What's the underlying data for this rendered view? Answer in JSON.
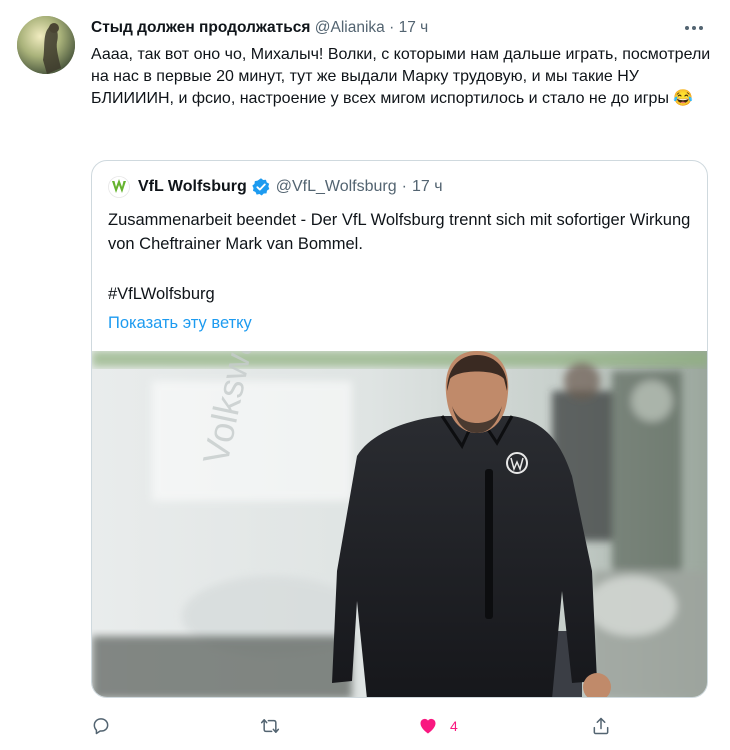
{
  "tweet": {
    "display_name": "Стыд должен продолжаться",
    "handle": "@Alianika",
    "separator": "·",
    "time": "17 ч",
    "text": "Аааа, так вот оно чо, Михалыч! Волки, с которыми нам дальше играть, посмотрели на нас в первые 20 минут, тут же выдали Марку трудовую, и мы такие НУ БЛИИИИН, и фсио, настроение у всех мигом испортилось и стало не до игры 😂"
  },
  "quote": {
    "display_name": "VfL Wolfsburg",
    "handle": "@VfL_Wolfsburg",
    "separator": "·",
    "time": "17 ч",
    "text": "Zusammenarbeit beendet - Der VfL Wolfsburg trennt sich mit sofortiger Wirkung von Cheftrainer Mark van Bommel.",
    "hashtag": "#VfLWolfsburg",
    "show_thread": "Показать эту ветку"
  },
  "actions": {
    "like_count": "4"
  },
  "colors": {
    "accent": "#1d9bf0",
    "like": "#f91880",
    "secondary_text": "#536471",
    "border": "#cfd9de",
    "brand_green": "#65b32e"
  },
  "icons": {
    "more": "more-icon",
    "verified": "verified-badge-icon",
    "reply": "reply-icon",
    "retweet": "retweet-icon",
    "like": "heart-filled-icon",
    "share": "share-icon"
  }
}
